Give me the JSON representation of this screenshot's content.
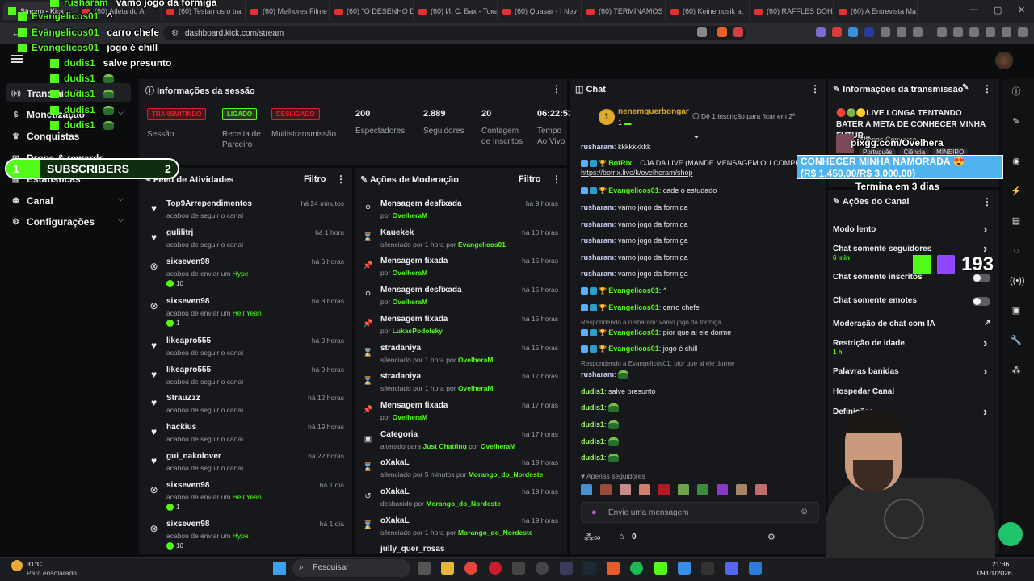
{
  "browser": {
    "active_tab": "Stream - Kick",
    "tabs": [
      "(60) Atleta do A",
      "(60) Testamos o tra",
      "(60) Melhores Filme",
      "(60) \"O DESENHO D",
      "(60) И. С. Бах - Тока",
      "(60) Quasar - I Nev",
      "(60) TERMINAMOS",
      "(60) Keinemusik at",
      "(60) RAFFLES DOHA",
      "(60) A Entrevista Ma"
    ],
    "url": "dashboard.kick.com/stream"
  },
  "sidebar": {
    "items": [
      {
        "label": "Transmissão",
        "icon": "broadcast-icon"
      },
      {
        "label": "Monetização",
        "icon": "dollar-icon"
      },
      {
        "label": "Conquistas",
        "icon": "trophy-icon"
      },
      {
        "label": "Drops & rewards",
        "icon": "gift-icon"
      },
      {
        "label": "Estatísticas",
        "icon": "chart-icon"
      },
      {
        "label": "Canal",
        "icon": "people-icon"
      },
      {
        "label": "Configurações",
        "icon": "gear-icon"
      }
    ]
  },
  "session": {
    "title": "Informações da sessão",
    "badges": [
      {
        "label": "TRANSMITINDO",
        "color": "#e21e2e",
        "caption": "Sessão"
      },
      {
        "label": "LIGADO",
        "color": "#53fc18",
        "caption": "Receita de Parceiro"
      },
      {
        "label": "DESLIGADO",
        "color": "#e21e2e",
        "caption": "Multistransmissão"
      }
    ],
    "stats": [
      {
        "value": "200",
        "label": "Espectadores"
      },
      {
        "value": "2.889",
        "label": "Seguidores"
      },
      {
        "value": "20",
        "label": "Contagem de Inscritos"
      },
      {
        "value": "06:22:53",
        "label": "Tempo Ao Vivo"
      }
    ]
  },
  "activity": {
    "title": "Feed de Atividades",
    "filter": "Filtro",
    "items": [
      {
        "icon": "heart-icon",
        "name": "Top9Arrependimentos",
        "sub": "acabou de seguir o canal",
        "time": "há 24 minutos"
      },
      {
        "icon": "heart-icon",
        "name": "gulilitrj",
        "sub": "acabou de seguir o canal",
        "time": "há 1 hora"
      },
      {
        "icon": "kick-icon",
        "name": "sixseven98",
        "sub": "acabou de enviar um",
        "hype": "Hype",
        "count": "10",
        "time": "há 6 horas"
      },
      {
        "icon": "kick-icon",
        "name": "sixseven98",
        "sub": "acabou de enviar um",
        "hype": "Hell Yeah",
        "count": "1",
        "time": "há 8 horas"
      },
      {
        "icon": "heart-icon",
        "name": "likeapro555",
        "sub": "acabou de seguir o canal",
        "time": "há 9 horas"
      },
      {
        "icon": "heart-icon",
        "name": "likeapro555",
        "sub": "acabou de seguir o canal",
        "time": "há 9 horas"
      },
      {
        "icon": "heart-icon",
        "name": "StrauZzz",
        "sub": "acabou de seguir o canal",
        "time": "há 12 horas"
      },
      {
        "icon": "heart-icon",
        "name": "hackius",
        "sub": "acabou de seguir o canal",
        "time": "há 19 horas"
      },
      {
        "icon": "heart-icon",
        "name": "gui_nakolover",
        "sub": "acabou de seguir o canal",
        "time": "há 22 horas"
      },
      {
        "icon": "kick-icon",
        "name": "sixseven98",
        "sub": "acabou de enviar um",
        "hype": "Hell Yeah",
        "count": "1",
        "time": "há 1 dia"
      },
      {
        "icon": "kick-icon",
        "name": "sixseven98",
        "sub": "acabou de enviar um",
        "hype": "Hype",
        "count": "10",
        "time": "há 1 dia"
      }
    ]
  },
  "moderation": {
    "title": "Ações de Moderação",
    "filter": "Filtro",
    "items": [
      {
        "icon": "unpin-icon",
        "name": "Mensagem desfixada",
        "pre": "por",
        "actor": "OvelheraM",
        "time": "há 9 horas"
      },
      {
        "icon": "hourglass-icon",
        "name": "Kauekek",
        "pre": "silenciado por 1 hora por",
        "actor": "Evangelicos01",
        "time": "há 10 horas"
      },
      {
        "icon": "pin-icon",
        "name": "Mensagem fixada",
        "pre": "por",
        "actor": "OvelheraM",
        "time": "há 15 horas"
      },
      {
        "icon": "unpin-icon",
        "name": "Mensagem desfixada",
        "pre": "por",
        "actor": "OvelheraM",
        "time": "há 15 horas"
      },
      {
        "icon": "pin-icon",
        "name": "Mensagem fixada",
        "pre": "por",
        "actor": "LukasPodolsky",
        "time": "há 15 horas"
      },
      {
        "icon": "hourglass-icon",
        "name": "stradaniya",
        "pre": "silenciado por 1 hora por",
        "actor": "OvelheraM",
        "time": "há 15 horas"
      },
      {
        "icon": "hourglass-icon",
        "name": "stradaniya",
        "pre": "silenciado por 1 hora por",
        "actor": "OvelheraM",
        "time": "há 17 horas"
      },
      {
        "icon": "pin-icon",
        "name": "Mensagem fixada",
        "pre": "por",
        "actor": "OvelheraM",
        "time": "há 17 horas"
      },
      {
        "icon": "category-icon",
        "name": "Categoria",
        "pre": "alterado para",
        "actor": "Just Chatting",
        "pre2": "por",
        "actor2": "OvelheraM",
        "time": "há 17 horas"
      },
      {
        "icon": "hourglass-icon",
        "name": "oXakaL",
        "pre": "silenciado por 5 minutos por",
        "actor": "Morango_do_Nordeste",
        "time": "há 19 horas"
      },
      {
        "icon": "undo-icon",
        "name": "oXakaL",
        "pre": "desbanido por",
        "actor": "Morango_do_Nordeste",
        "time": "há 19 horas"
      },
      {
        "icon": "hourglass-icon",
        "name": "oXakaL",
        "pre": "silenciado por 1 hora por",
        "actor": "Morango_do_Nordeste",
        "time": "há 19 horas"
      }
    ],
    "last_partial": "jully_quer_rosas"
  },
  "chat": {
    "title": "Chat",
    "pinned_user": "nenemquerbongar",
    "pinned_rank": "1",
    "pinned_count": "1",
    "pinned_note": "Dê 1 inscrição para ficar em 2º",
    "messages": [
      {
        "user": "rusharam",
        "text": "kkkkkkkkk",
        "cls": "u-rush"
      },
      {
        "user": "BotRix",
        "text": "LOJA DA LIVE (MANDE MENSAGEM OU COMPRE",
        "link": "https://botrix.live/k/ovelheram/shop",
        "cls": "u-evan"
      },
      {
        "user": "Evangelicos01",
        "text": "cade o estudado",
        "cls": "u-evan"
      },
      {
        "user": "rusharam",
        "text": "vamo jogo da formiga",
        "cls": "u-rush"
      },
      {
        "user": "rusharam",
        "text": "vamo jogo da formiga",
        "cls": "u-rush"
      },
      {
        "user": "rusharam",
        "text": "vamo jogo da formiga",
        "cls": "u-rush"
      },
      {
        "user": "rusharam",
        "text": "vamo jogo da formiga",
        "cls": "u-rush"
      },
      {
        "user": "rusharam",
        "text": "vamo jogo da formiga",
        "cls": "u-rush"
      },
      {
        "user": "Evangelicos01",
        "text": "^",
        "cls": "u-evan"
      },
      {
        "user": "Evangelicos01",
        "text": "carro chefe",
        "cls": "u-evan"
      },
      {
        "reply": "Respondendo a rusharam: vamo jogo da formiga"
      },
      {
        "user": "Evangelicos01",
        "text": "pior que ai ele dorme",
        "cls": "u-evan"
      },
      {
        "user": "Evangelicos01",
        "text": "jogo é chill",
        "cls": "u-evan"
      },
      {
        "reply": "Respondendo a Evangelicos01: pior que ai ele dorme"
      },
      {
        "user": "rusharam",
        "text": "",
        "cls": "u-rush",
        "emote": true
      },
      {
        "user": "dudis1",
        "text": "salve presunto",
        "cls": "u-dud"
      },
      {
        "user": "dudis1",
        "text": "",
        "cls": "u-dud",
        "emote": true
      },
      {
        "user": "dudis1",
        "text": "",
        "cls": "u-dud",
        "emote": true
      },
      {
        "user": "dudis1",
        "text": "",
        "cls": "u-dud",
        "emote": true
      },
      {
        "user": "dudis1",
        "text": "",
        "cls": "u-dud",
        "emote": true
      }
    ],
    "followers_only": "Apenas seguidores",
    "input_placeholder": "Envie uma mensagem",
    "points": "0"
  },
  "broadcast": {
    "title": "Informações da transmissão",
    "stream_title": "🔴🟢🟡LIVE LONGA TENTANDO BATER A META DE CONHECER MINHA FUTUR...",
    "tags": [
      "Português",
      "Ciência",
      "MINEIRO"
    ],
    "category": "Apenas Conversa"
  },
  "channel_actions": {
    "title": "Ações do Canal",
    "items": [
      {
        "label": "Modo lento",
        "type": "chevron"
      },
      {
        "label": "Chat somente seguidores",
        "sub": "6 min",
        "type": "chevron"
      },
      {
        "label": "Chat somente inscritos",
        "type": "toggle"
      },
      {
        "label": "Chat somente emotes",
        "type": "toggle"
      },
      {
        "label": "Moderação de chat com IA",
        "type": "external"
      },
      {
        "label": "Restrição de idade",
        "sub": "1 h",
        "type": "chevron"
      },
      {
        "label": "Palavras banidas",
        "type": "chevron"
      },
      {
        "label": "Hospedar Canal",
        "type": "none"
      },
      {
        "label": "Definições",
        "type": "chevron"
      }
    ]
  },
  "overlay": {
    "chat": [
      {
        "user": "rusharam",
        "text": "vamo jogo da formiga"
      },
      {
        "user": "Evangelicos01",
        "text": "^"
      },
      {
        "user": "Evangelicos01",
        "text": "carro chefe"
      },
      {
        "user": "Evangelicos01",
        "text": "jogo é chill"
      },
      {
        "user": "dudis1",
        "text": "salve presunto"
      },
      {
        "user": "dudis1",
        "text": ""
      },
      {
        "user": "dudis1",
        "text": ""
      },
      {
        "user": "dudis1",
        "text": ""
      },
      {
        "user": "dudis1",
        "text": ""
      }
    ],
    "sub_left": "1",
    "sub_label": "SUBSCRIBERS",
    "sub_right": "2",
    "pix": "pixgg.com/Ovelhera",
    "goal": "CONHECER MINHA NAMORADA 😍",
    "goal_amount": "(R$ 1.450,00/R$ 3.000,00)",
    "goal_end": "Termina em 3 dias",
    "viewer_count": "193"
  },
  "taskbar": {
    "weather_temp": "31°C",
    "weather_desc": "Parc ensolarado",
    "search": "Pesquisar",
    "time": "21:36",
    "date": "09/01/2026"
  }
}
